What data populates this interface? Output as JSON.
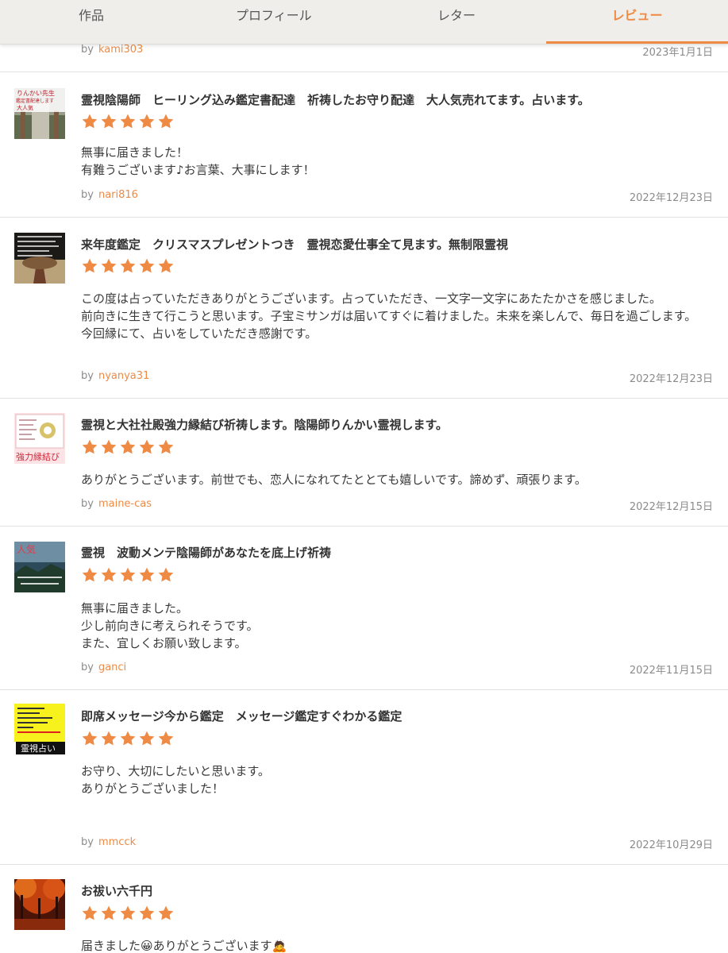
{
  "tabs": [
    {
      "label": "作品"
    },
    {
      "label": "プロフィール"
    },
    {
      "label": "レター"
    },
    {
      "label": "レビュー",
      "active": true
    }
  ],
  "accent_color": "#ef8a44",
  "by_label": "by",
  "partial_review": {
    "user": "kami303",
    "date": "2023年1月1日"
  },
  "reviews": [
    {
      "title": "霊視陰陽師　ヒーリング込み鑑定書配達　祈祷したお守り配達　大人気売れてます。占います。",
      "rating": 5,
      "body": "無事に届きました！\n有難うございます♪お言葉、大事にします！",
      "user": "nari816",
      "date": "2022年12月23日",
      "thumb_text": [
        "りんかい先生",
        "鑑定書配達します",
        "大人気"
      ]
    },
    {
      "title": "来年度鑑定　クリスマスプレゼントつき　霊視恋愛仕事全て見ます。無制限霊視",
      "rating": 5,
      "body": "この度は占っていただきありがとうございます。占っていただき、一文字一文字にあたたかさを感じました。\n前向きに生きて行こうと思います。子宝ミサンガは届いてすぐに着けました。未来を楽しんで、毎日を過ごします。\n今回縁にて、占いをしていただき感謝です。",
      "user": "nyanya31",
      "date": "2022年12月23日",
      "thumb_text": []
    },
    {
      "title": "霊視と大社社殿強力縁結び祈祷します。陰陽師りんかい霊視します。",
      "rating": 5,
      "body": "ありがとうございます。前世でも、恋人になれてたととても嬉しいです。諦めず、頑張ります。",
      "user": "maine-cas",
      "date": "2022年12月15日",
      "thumb_text": [
        "強力縁結び"
      ]
    },
    {
      "title": "霊視　波動メンテ陰陽師があなたを底上げ祈祷",
      "rating": 5,
      "body": "無事に届きました。\n少し前向きに考えられそうです。\nまた、宜しくお願い致します。",
      "user": "ganci",
      "date": "2022年11月15日",
      "thumb_text": [
        "人気"
      ]
    },
    {
      "title": "即席メッセージ今から鑑定　メッセージ鑑定すぐわかる鑑定",
      "rating": 5,
      "body": "お守り、大切にしたいと思います。\nありがとうございました！",
      "user": "mmcck",
      "date": "2022年10月29日",
      "thumb_text": [
        "霊視占い"
      ]
    },
    {
      "title": "お祓い六千円",
      "rating": 5,
      "body": "届きました😀ありがとうございます🙇",
      "user": "",
      "date": "",
      "thumb_text": []
    }
  ]
}
